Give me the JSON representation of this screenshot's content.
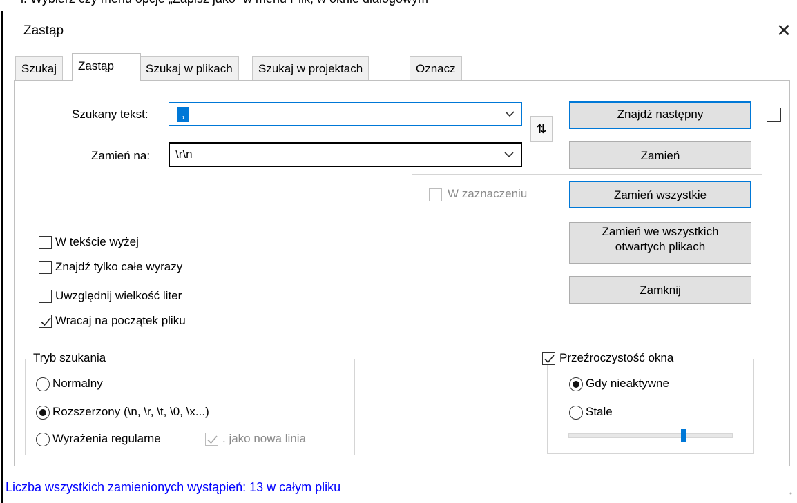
{
  "top_strip_text": "i. Wybierz czy menu opcje „Zapisz jako” w menu Plik; w oknie dialogowym",
  "window": {
    "title": "Zastąp"
  },
  "tabs": [
    {
      "label": "Szukaj",
      "active": false
    },
    {
      "label": "Zastąp",
      "active": true
    },
    {
      "label": "Szukaj w plikach",
      "active": false
    },
    {
      "label": "Szukaj w projektach",
      "active": false
    },
    {
      "label": "Oznacz",
      "active": false
    }
  ],
  "find": {
    "label": "Szukany tekst:",
    "value": ","
  },
  "replace": {
    "label": "Zamień na:",
    "value": "\\r\\n"
  },
  "swap_icon": "⇅",
  "buttons": {
    "find_next": "Znajdź następny",
    "replace": "Zamień",
    "replace_all": "Zamień wszystkie",
    "replace_all_open_line1": "Zamień we wszystkich",
    "replace_all_open_line2": "otwartych plikach",
    "close": "Zamknij"
  },
  "in_selection": {
    "label": "W zaznaczeniu",
    "checked": false,
    "disabled": true
  },
  "options": [
    {
      "label": "W tekście wyżej",
      "checked": false
    },
    {
      "label": "Znajdź tylko całe wyrazy",
      "checked": false
    },
    {
      "label": "Uwzględnij wielkość liter",
      "checked": false
    },
    {
      "label": "Wracaj na początek pliku",
      "checked": true
    }
  ],
  "search_mode": {
    "legend": "Tryb szukania",
    "modes": [
      {
        "label": "Normalny",
        "selected": false
      },
      {
        "label": "Rozszerzony (\\n, \\r, \\t, \\0, \\x...)",
        "selected": true
      },
      {
        "label": "Wyrażenia regularne",
        "selected": false
      }
    ],
    "dot_newline": {
      "label": ". jako nowa linia",
      "checked": true,
      "disabled": true
    }
  },
  "transparency": {
    "label": "Przeźroczystość okna",
    "checked": true,
    "modes": [
      {
        "label": "Gdy nieaktywne",
        "selected": true
      },
      {
        "label": "Stale",
        "selected": false
      }
    ],
    "slider_level": 0.7
  },
  "status_text": "Liczba wszystkich zamienionych wystąpień: 13 w całym pliku",
  "colors": {
    "accent": "#0078d7",
    "status": "#0000ff",
    "button_face": "#e1e1e1"
  }
}
